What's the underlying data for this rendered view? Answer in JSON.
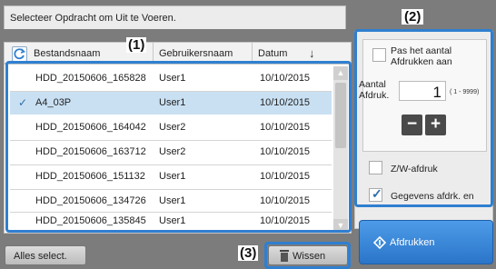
{
  "instruction": "Selecteer Opdracht om Uit te Voeren.",
  "callouts": {
    "one": "(1)",
    "two": "(2)",
    "three": "(3)"
  },
  "list": {
    "columns": {
      "filename": "Bestandsnaam",
      "user": "Gebruikersnaam",
      "date": "Datum"
    },
    "sort_icon": "sort-arrow-icon",
    "rows": [
      {
        "filename": "HDD_20150606_165828",
        "user": "User1",
        "date": "10/10/2015",
        "selected": false
      },
      {
        "filename": "A4_03P",
        "user": "User1",
        "date": "10/10/2015",
        "selected": true
      },
      {
        "filename": "HDD_20150606_164042",
        "user": "User2",
        "date": "10/10/2015",
        "selected": false
      },
      {
        "filename": "HDD_20150606_163712",
        "user": "User2",
        "date": "10/10/2015",
        "selected": false
      },
      {
        "filename": "HDD_20150606_151132",
        "user": "User1",
        "date": "10/10/2015",
        "selected": false
      },
      {
        "filename": "HDD_20150606_134726",
        "user": "User1",
        "date": "10/10/2015",
        "selected": false
      },
      {
        "filename": "HDD_20150606_135845",
        "user": "User1",
        "date": "10/10/2015",
        "selected": false
      }
    ]
  },
  "settings": {
    "adjust_count": {
      "label": "Pas het aantal Afdrukken aan",
      "checked": false
    },
    "count_label": "Aantal Afdruk.",
    "count_value": "1",
    "count_range": "( 1 - 9999)",
    "minus": "−",
    "plus": "+",
    "bw_print": {
      "label": "Z/W-afdruk",
      "checked": false
    },
    "print_and_delete": {
      "label": "Gegevens afdrk. en",
      "checked": true
    }
  },
  "buttons": {
    "select_all": "Alles select.",
    "delete": "Wissen",
    "print": "Afdrukken"
  },
  "colors": {
    "accent": "#2f7fd0",
    "selected_row": "#c9e0f3",
    "print_button": "#2b75c9"
  }
}
